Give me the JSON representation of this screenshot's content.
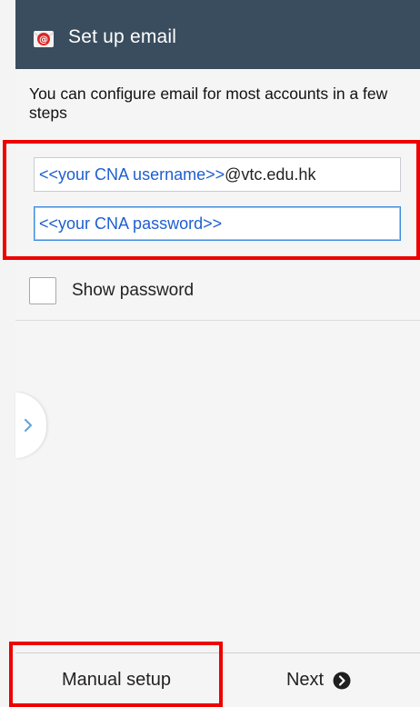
{
  "action_bar": {
    "title": "Set up email",
    "icon": "email-app-icon"
  },
  "intro_text": "You can configure email for most accounts in a few steps",
  "fields": {
    "username": {
      "hint": "<<your CNA username>>",
      "typed": "@vtc.edu.hk"
    },
    "password": {
      "hint": "<<your CNA password>>"
    }
  },
  "show_password": {
    "label": "Show password",
    "checked": false
  },
  "footer": {
    "manual_setup_label": "Manual setup",
    "next_label": "Next",
    "next_icon": "chevron-right-circle-icon"
  },
  "colors": {
    "action_bar": "#3a4d5f",
    "hint_text": "#1e5fd0",
    "highlight": "#ee0000",
    "focus_border": "#3d8ee0"
  }
}
